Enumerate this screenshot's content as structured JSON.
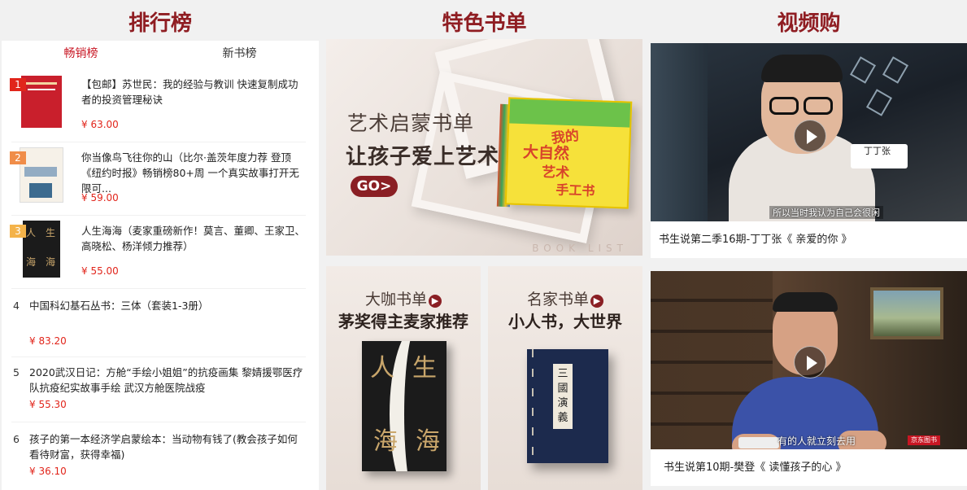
{
  "headers": {
    "ranking": "排行榜",
    "booklist": "特色书单",
    "video": "视频购"
  },
  "tabs": [
    {
      "label": "畅销榜",
      "active": true
    },
    {
      "label": "新书榜",
      "active": false
    }
  ],
  "ranking_items": [
    {
      "rank": "1",
      "title": "【包邮】苏世民：我的经验与教训 快速复制成功者的投资管理秘诀",
      "price": "¥ 63.00",
      "badge_color": "#e1251b"
    },
    {
      "rank": "2",
      "title": "你当像鸟飞往你的山（比尔·盖茨年度力荐 登顶《纽约时报》畅销榜80+周 一个真实故事打开无限可...",
      "price": "¥ 59.00",
      "badge_color": "#f08d49"
    },
    {
      "rank": "3",
      "title": "人生海海（麦家重磅新作！莫言、董卿、王家卫、高晓松、杨洋倾力推荐）",
      "price": "¥ 55.00",
      "badge_color": "#f4b34a"
    },
    {
      "rank": "4",
      "title": "中国科幻基石丛书：三体（套装1-3册）",
      "price": "¥ 83.20"
    },
    {
      "rank": "5",
      "title": "2020武汉日记：方舱“手绘小姐姐”的抗疫画集 黎婧援鄂医疗队抗疫纪实故事手绘 武汉方舱医院战疫",
      "price": "¥ 55.30"
    },
    {
      "rank": "6",
      "title": "孩子的第一本经济学启蒙绘本：当动物有钱了(教会孩子如何看待财富，获得幸福)",
      "price": "¥ 36.10"
    }
  ],
  "booklist": {
    "main": {
      "line1": "艺术启蒙书单",
      "line2": "让孩子爱上艺术",
      "go": "GO>",
      "footer": "BOOK LIST"
    },
    "cards": [
      {
        "line1": "大咖书单",
        "line2": "茅奖得主麦家推荐"
      },
      {
        "line1": "名家书单",
        "line2": "小人书，大世界"
      }
    ]
  },
  "videos": [
    {
      "caption": "书生说第二季16期-丁丁张《 亲爱的你 》",
      "subtitle": "所以当时我认为自己会很闲",
      "name_card": "丁丁张"
    },
    {
      "caption": "书生说第10期-樊登《 读懂孩子的心 》",
      "subtitle": "有的人就立刻去用",
      "brand": "京东图书"
    }
  ],
  "colors": {
    "header": "#8f1d22",
    "price": "#e1251b",
    "tab_active": "#c81623"
  }
}
